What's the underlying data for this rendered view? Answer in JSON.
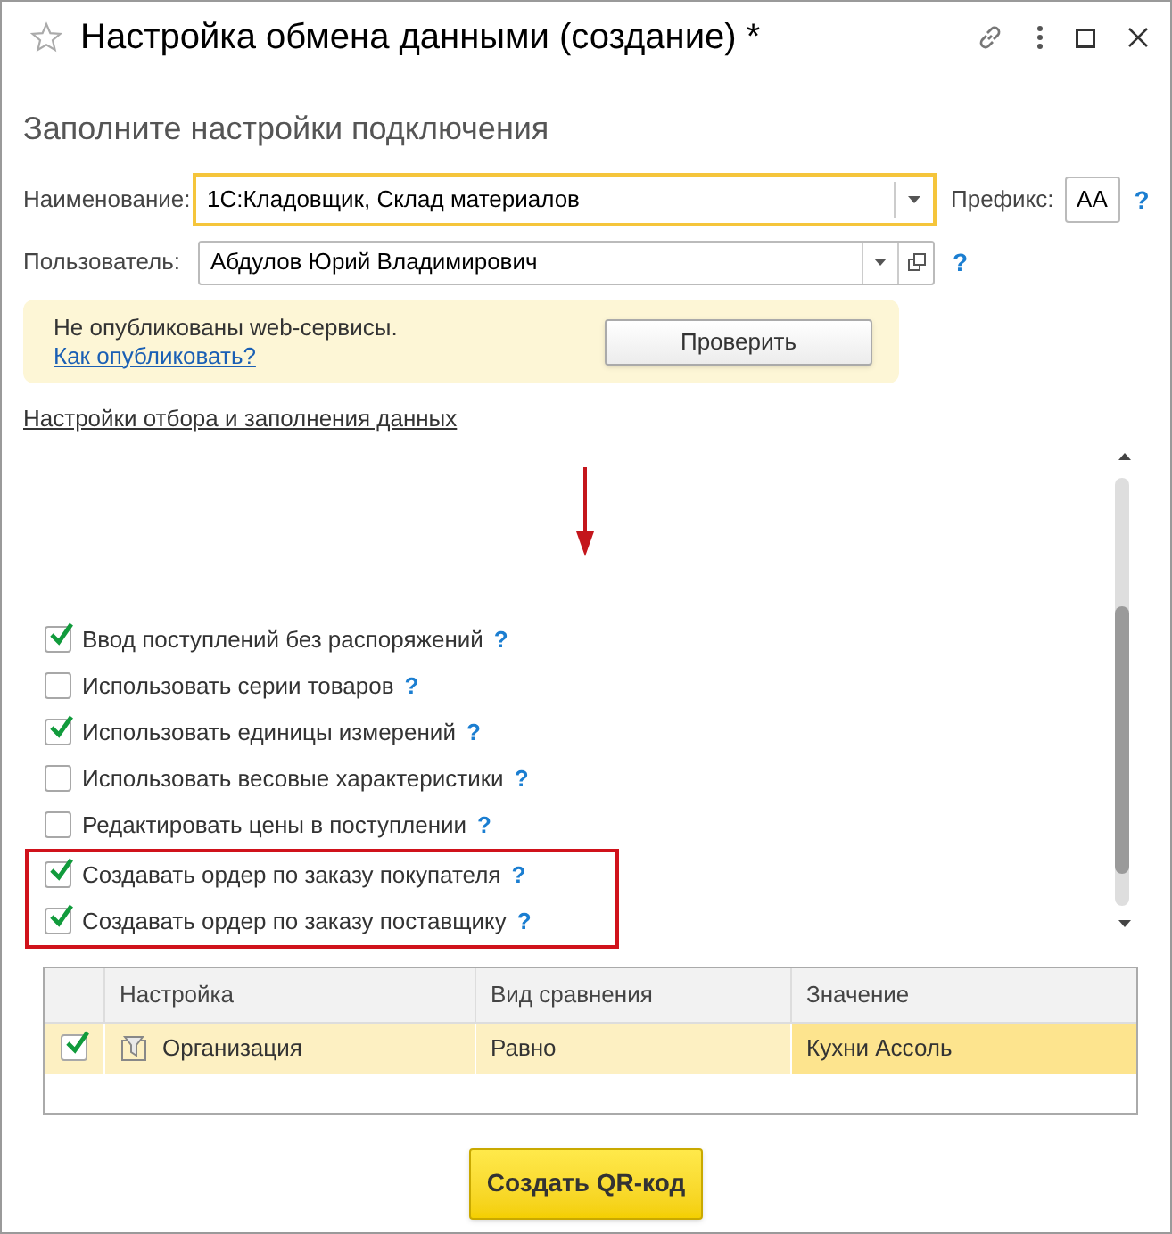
{
  "window": {
    "title": "Настройка обмена данными (создание) *",
    "favorite": false
  },
  "heading": "Заполните настройки подключения",
  "name_field": {
    "label": "Наименование:",
    "value": "1С:Кладовщик, Склад материалов",
    "focused": true
  },
  "prefix_field": {
    "label": "Префикс:",
    "value": "АА",
    "help": "?"
  },
  "user_field": {
    "label": "Пользователь:",
    "value": "Абдулов Юрий Владимирович",
    "help": "?"
  },
  "notice": {
    "text": "Не опубликованы web-сервисы.",
    "link": "Как опубликовать?",
    "button": "Проверить"
  },
  "section_link": "Настройки отбора и заполнения данных",
  "options": [
    {
      "label": "Ввод поступлений без распоряжений",
      "checked": true,
      "highlighted": false,
      "help": "?"
    },
    {
      "label": "Использовать серии товаров",
      "checked": false,
      "highlighted": false,
      "help": "?"
    },
    {
      "label": "Использовать единицы измерений",
      "checked": true,
      "highlighted": false,
      "help": "?"
    },
    {
      "label": "Использовать весовые характеристики",
      "checked": false,
      "highlighted": false,
      "help": "?"
    },
    {
      "label": "Редактировать цены в поступлении",
      "checked": false,
      "highlighted": false,
      "help": "?"
    },
    {
      "label": "Создавать ордер по заказу покупателя",
      "checked": true,
      "highlighted": true,
      "help": "?"
    },
    {
      "label": "Создавать ордер по заказу поставщику",
      "checked": true,
      "highlighted": true,
      "help": "?"
    }
  ],
  "table": {
    "columns": [
      "Настройка",
      "Вид сравнения",
      "Значение"
    ],
    "rows": [
      {
        "checked": true,
        "selected": true,
        "cells": [
          {
            "text": "Организация",
            "active": false
          },
          {
            "text": "Равно",
            "active": false
          },
          {
            "text": "Кухни Ассоль",
            "active": true
          }
        ]
      }
    ]
  },
  "primary_button": "Создать QR-код"
}
